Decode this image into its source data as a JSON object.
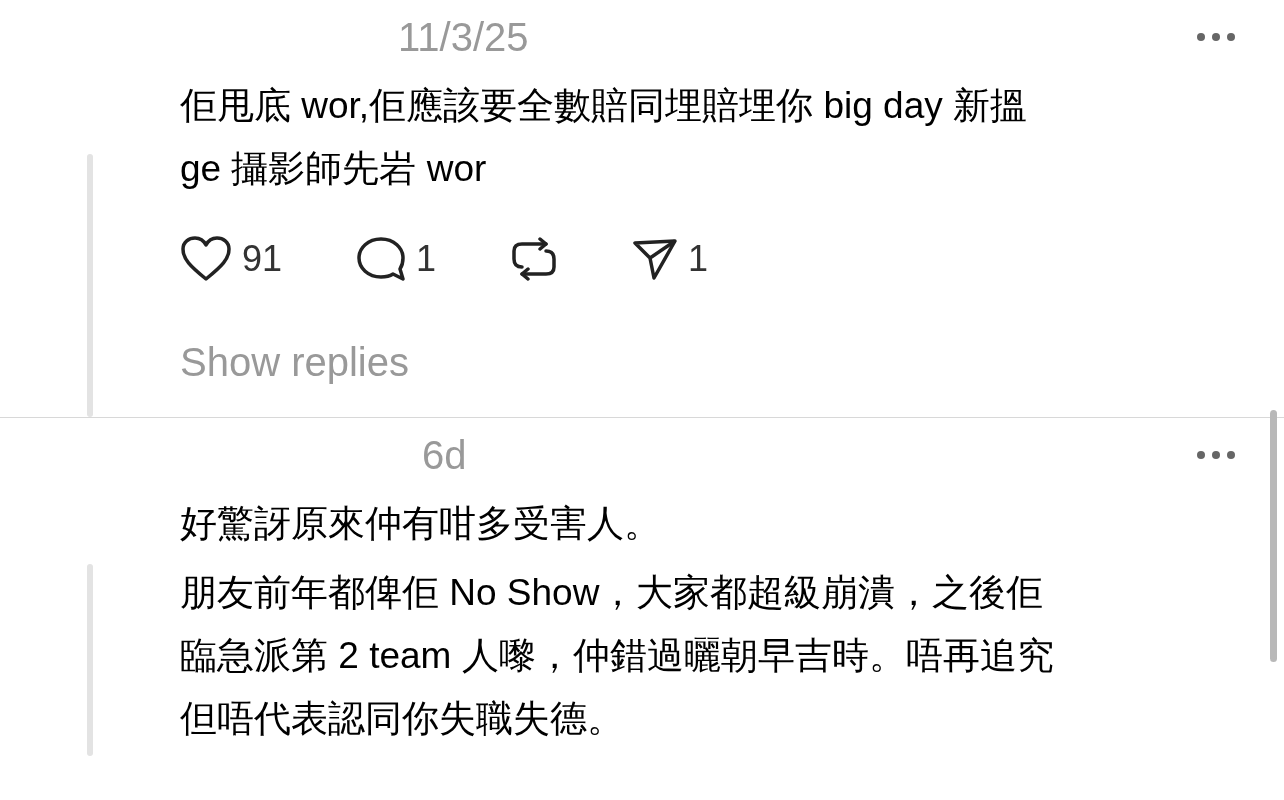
{
  "posts": [
    {
      "time": "11/3/25",
      "paragraphs": [
        [
          "佢甩底 wor,佢應該要全數賠同埋賠埋你 big day 新搵",
          "ge 攝影師先岩 wor"
        ]
      ],
      "actions": [
        {
          "kind": "like",
          "count": "91"
        },
        {
          "kind": "reply",
          "count": "1"
        },
        {
          "kind": "repost"
        },
        {
          "kind": "share",
          "count": "1"
        }
      ],
      "show_replies": "Show replies"
    },
    {
      "time": "6d",
      "paragraphs": [
        [
          "好驚訝原來仲有咁多受害人。"
        ],
        [
          "朋友前年都俾佢 No Show，大家都超級崩潰，之後佢",
          "臨急派第 2 team 人嚟，仲錯過曬朝早吉時。唔再追究",
          "但唔代表認同你失職失德。"
        ]
      ]
    }
  ]
}
